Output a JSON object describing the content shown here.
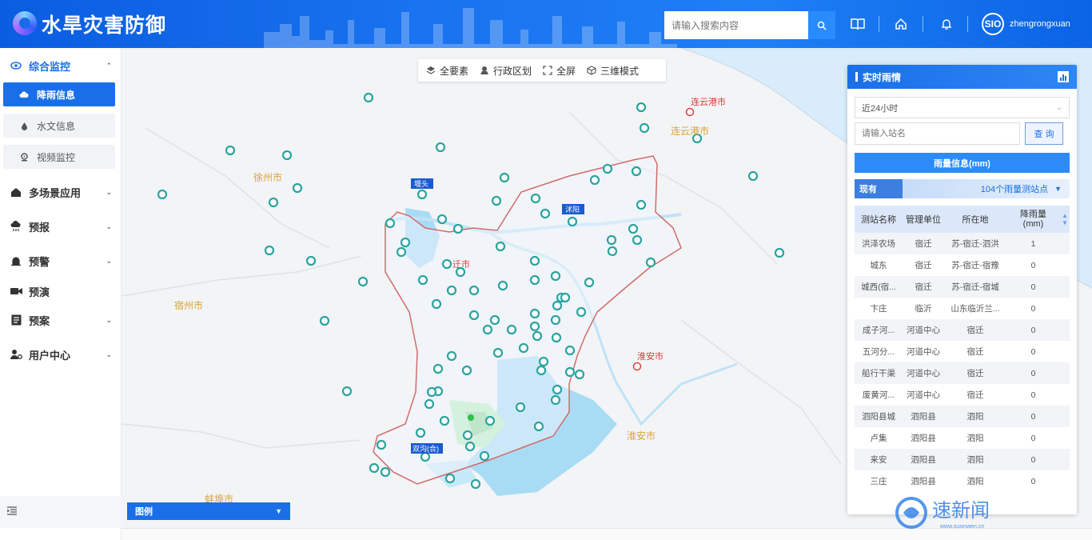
{
  "app": {
    "title": "水旱灾害防御"
  },
  "header": {
    "search_placeholder": "请输入搜索内容",
    "icons": [
      "book-icon",
      "home-icon",
      "bell-icon"
    ],
    "username": "zhengrongxuan",
    "avatar_text": "SIO"
  },
  "sidebar": {
    "groups": [
      {
        "label": "综合监控",
        "icon": "eye-icon",
        "expanded": true
      },
      {
        "label": "多场景应用",
        "icon": "home-icon"
      },
      {
        "label": "预报",
        "icon": "cloud-rain-icon"
      },
      {
        "label": "预警",
        "icon": "alarm-icon"
      },
      {
        "label": "预演",
        "icon": "video-icon"
      },
      {
        "label": "预案",
        "icon": "document-icon"
      },
      {
        "label": "用户中心",
        "icon": "user-gear-icon"
      }
    ],
    "sub_items": [
      {
        "label": "降雨信息",
        "icon": "cloud-icon",
        "active": true
      },
      {
        "label": "水文信息",
        "icon": "drop-icon"
      },
      {
        "label": "视频监控",
        "icon": "camera-icon"
      }
    ]
  },
  "map": {
    "toolbar": [
      {
        "label": "全要素",
        "icon": "layers-icon"
      },
      {
        "label": "行政区划",
        "icon": "region-icon"
      },
      {
        "label": "全屏",
        "icon": "fullscreen-icon"
      },
      {
        "label": "三维模式",
        "icon": "cube-icon"
      }
    ],
    "labels": {
      "lianyungang": "连云港市",
      "lianyungang2": "连云港市",
      "xuzhou": "徐州市",
      "suzhou": "宿州市",
      "huaian": "淮安市",
      "huaian2": "淮安市",
      "bengbu": "蚌埠市",
      "city_mid": "迁市",
      "yantou": "堰头",
      "shuyang": "沭阳",
      "shuanggou": "双沟(合)"
    },
    "legend_label": "图例"
  },
  "panel": {
    "title": "实时雨情",
    "time_select": "近24小时",
    "station_placeholder": "请输入站名",
    "query_label": "查 询",
    "rain_button": "雨量信息(mm)",
    "status_label": "现有",
    "status_count": "104个雨量测站点",
    "columns": [
      "测站名称",
      "管理单位",
      "所在地",
      "降雨量\n(mm)"
    ],
    "rows": [
      [
        "洪泽农场",
        "宿迁",
        "苏-宿迁-泗洪",
        "1"
      ],
      [
        "城东",
        "宿迁",
        "苏-宿迁-宿豫",
        "0"
      ],
      [
        "城西(宿...",
        "宿迁",
        "苏-宿迁-宿城",
        "0"
      ],
      [
        "卞庄",
        "临沂",
        "山东临沂兰...",
        "0"
      ],
      [
        "成子河...",
        "河道中心",
        "宿迁",
        "0"
      ],
      [
        "五河分...",
        "河道中心",
        "宿迁",
        "0"
      ],
      [
        "船行干渠",
        "河道中心",
        "宿迁",
        "0"
      ],
      [
        "废黄河...",
        "河道中心",
        "宿迁",
        "0"
      ],
      [
        "泗阳县城",
        "泗阳县",
        "泗阳",
        "0"
      ],
      [
        "卢集",
        "泗阳县",
        "泗阳",
        "0"
      ],
      [
        "来安",
        "泗阳县",
        "泗阳",
        "0"
      ],
      [
        "三庄",
        "泗阳县",
        "泗阳",
        "0"
      ]
    ]
  },
  "watermark": {
    "brand": "速新闻",
    "url": "www.suxinwen.cn"
  }
}
